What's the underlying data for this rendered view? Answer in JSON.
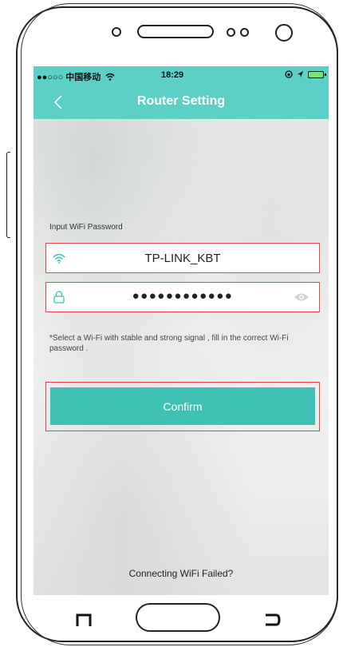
{
  "status_bar": {
    "carrier": "●●○○○ 中国移动",
    "time": "18:29"
  },
  "nav": {
    "title": "Router Setting"
  },
  "form": {
    "label": "Input WiFi Password",
    "ssid": "TP-LINK_KBT",
    "password_masked": "●●●●●●●●●●●●",
    "hint": "*Select a Wi-Fi with stable and strong signal , fill in the correct Wi-Fi password ."
  },
  "buttons": {
    "confirm": "Confirm",
    "failed_link": "Connecting WiFi Failed?"
  },
  "colors": {
    "header": "#5ccfc6",
    "confirm_button": "#3fc0b5",
    "highlight_border": "#e0464a"
  },
  "icons": [
    "back-arrow-icon",
    "wifi-icon",
    "lock-icon",
    "eye-icon",
    "signal-icon",
    "battery-icon"
  ]
}
